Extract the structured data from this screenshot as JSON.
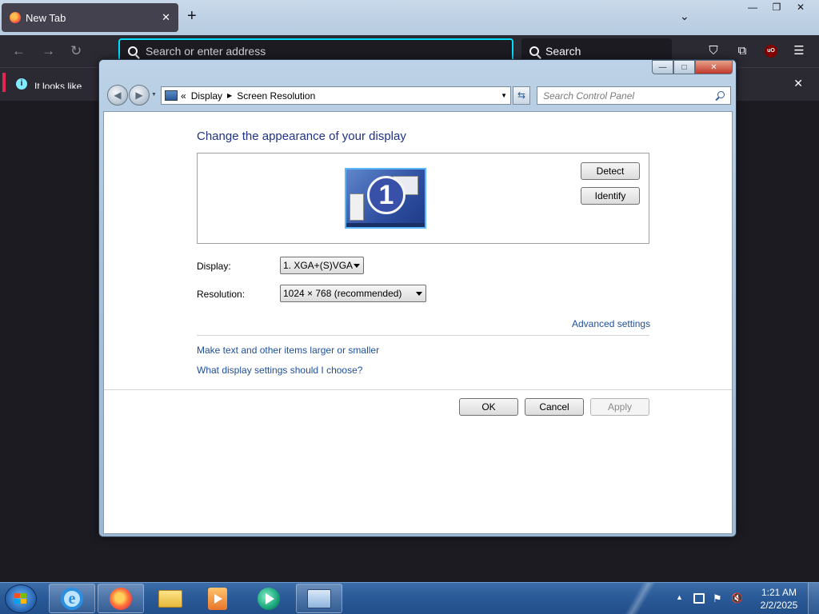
{
  "browser": {
    "tab_title": "New Tab",
    "tab_close": "✕",
    "new_tab": "+",
    "list_tabs": "⌄",
    "url_placeholder": "Search or enter address",
    "search_label": "Search",
    "notification_text": "It looks like",
    "notification_close": "✕",
    "window_controls": {
      "minimize": "—",
      "restore": "❐",
      "close": "✕"
    },
    "icons": [
      "back-arrow-icon",
      "forward-arrow-icon",
      "reload-icon",
      "pocket-icon",
      "extensions-icon",
      "ublock-icon",
      "menu-icon"
    ],
    "ublock_label": "uO",
    "accent_color": "#00ddff"
  },
  "control_panel": {
    "breadcrumb": {
      "prefix": "«",
      "items": [
        "Display",
        "Screen Resolution"
      ]
    },
    "search_placeholder": "Search Control Panel",
    "caption": {
      "minimize": "—",
      "maximize": "□",
      "close": "✕"
    },
    "title": "Change the appearance of your display",
    "monitor_number": "1",
    "detect_button": "Detect",
    "identify_button": "Identify",
    "display_label": "Display:",
    "display_value": "1. XGA+(S)VGA",
    "resolution_label": "Resolution:",
    "resolution_value": "1024 × 768 (recommended)",
    "advanced_link": "Advanced settings",
    "link_text_size": "Make text and other items larger or smaller",
    "link_help": "What display settings should I choose?",
    "ok_button": "OK",
    "cancel_button": "Cancel",
    "apply_button": "Apply",
    "title_color": "#1e3287",
    "link_color": "#1e4e9c"
  },
  "taskbar": {
    "pinned": [
      "Internet Explorer",
      "Firefox",
      "File Explorer",
      "Media Player",
      "App",
      "Control Panel"
    ],
    "time": "1:21 AM",
    "date": "2/2/2025"
  }
}
